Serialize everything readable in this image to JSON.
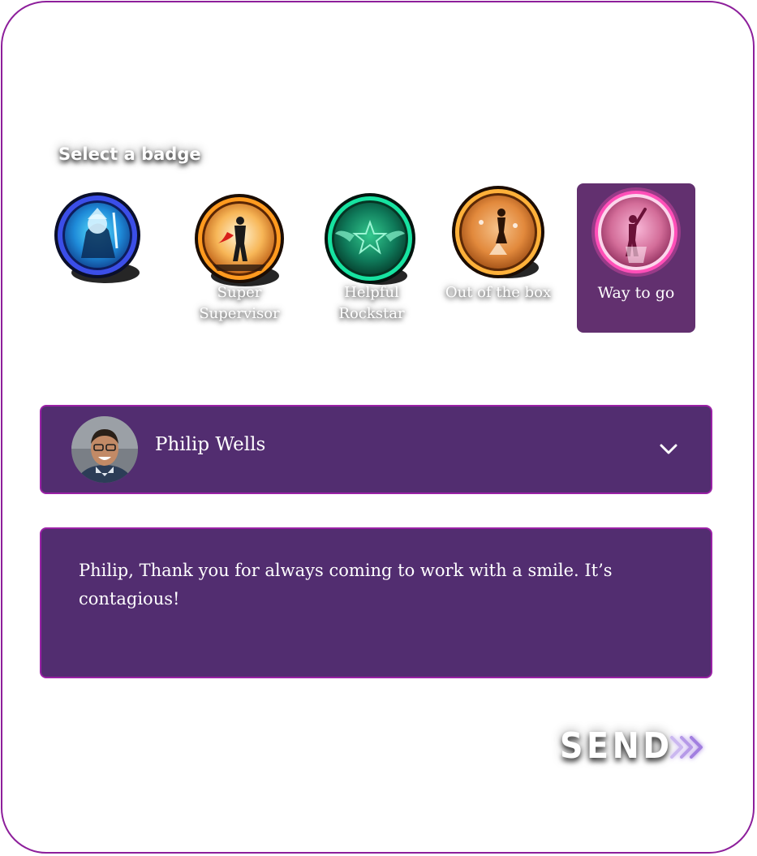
{
  "badges_section": {
    "title": "Select a badge",
    "badges": [
      {
        "label": "",
        "theme": "blue",
        "ring": "#4a6bff",
        "icon": "knight-badge-icon",
        "selected": false
      },
      {
        "label": "Super Supervisor",
        "theme": "amber",
        "ring": "#ff9a1f",
        "icon": "superhero-badge-icon",
        "selected": false
      },
      {
        "label": "Helpful Rockstar",
        "theme": "green",
        "ring": "#17e3a1",
        "icon": "winged-star-badge-icon",
        "selected": false
      },
      {
        "label": "Out of the box",
        "theme": "orange",
        "ring": "#ffb13a",
        "icon": "jack-in-the-box-badge-icon",
        "selected": false
      },
      {
        "label": "Way to go",
        "theme": "pink",
        "ring": "#ff4fb8",
        "icon": "cheering-person-badge-icon",
        "selected": true
      }
    ]
  },
  "recipient": {
    "name": "Philip Wells",
    "avatar_icon": "user-avatar",
    "dropdown_icon": "chevron-down-icon"
  },
  "message": {
    "text": "Philip, Thank you for always coming to work with a smile. It’s contagious!"
  },
  "send": {
    "label": "SEND",
    "icon": "triple-chevron-right-icon"
  },
  "colors": {
    "border": "#8d1f9b",
    "panel": "#522d70",
    "selected_badge": "#62306f"
  }
}
